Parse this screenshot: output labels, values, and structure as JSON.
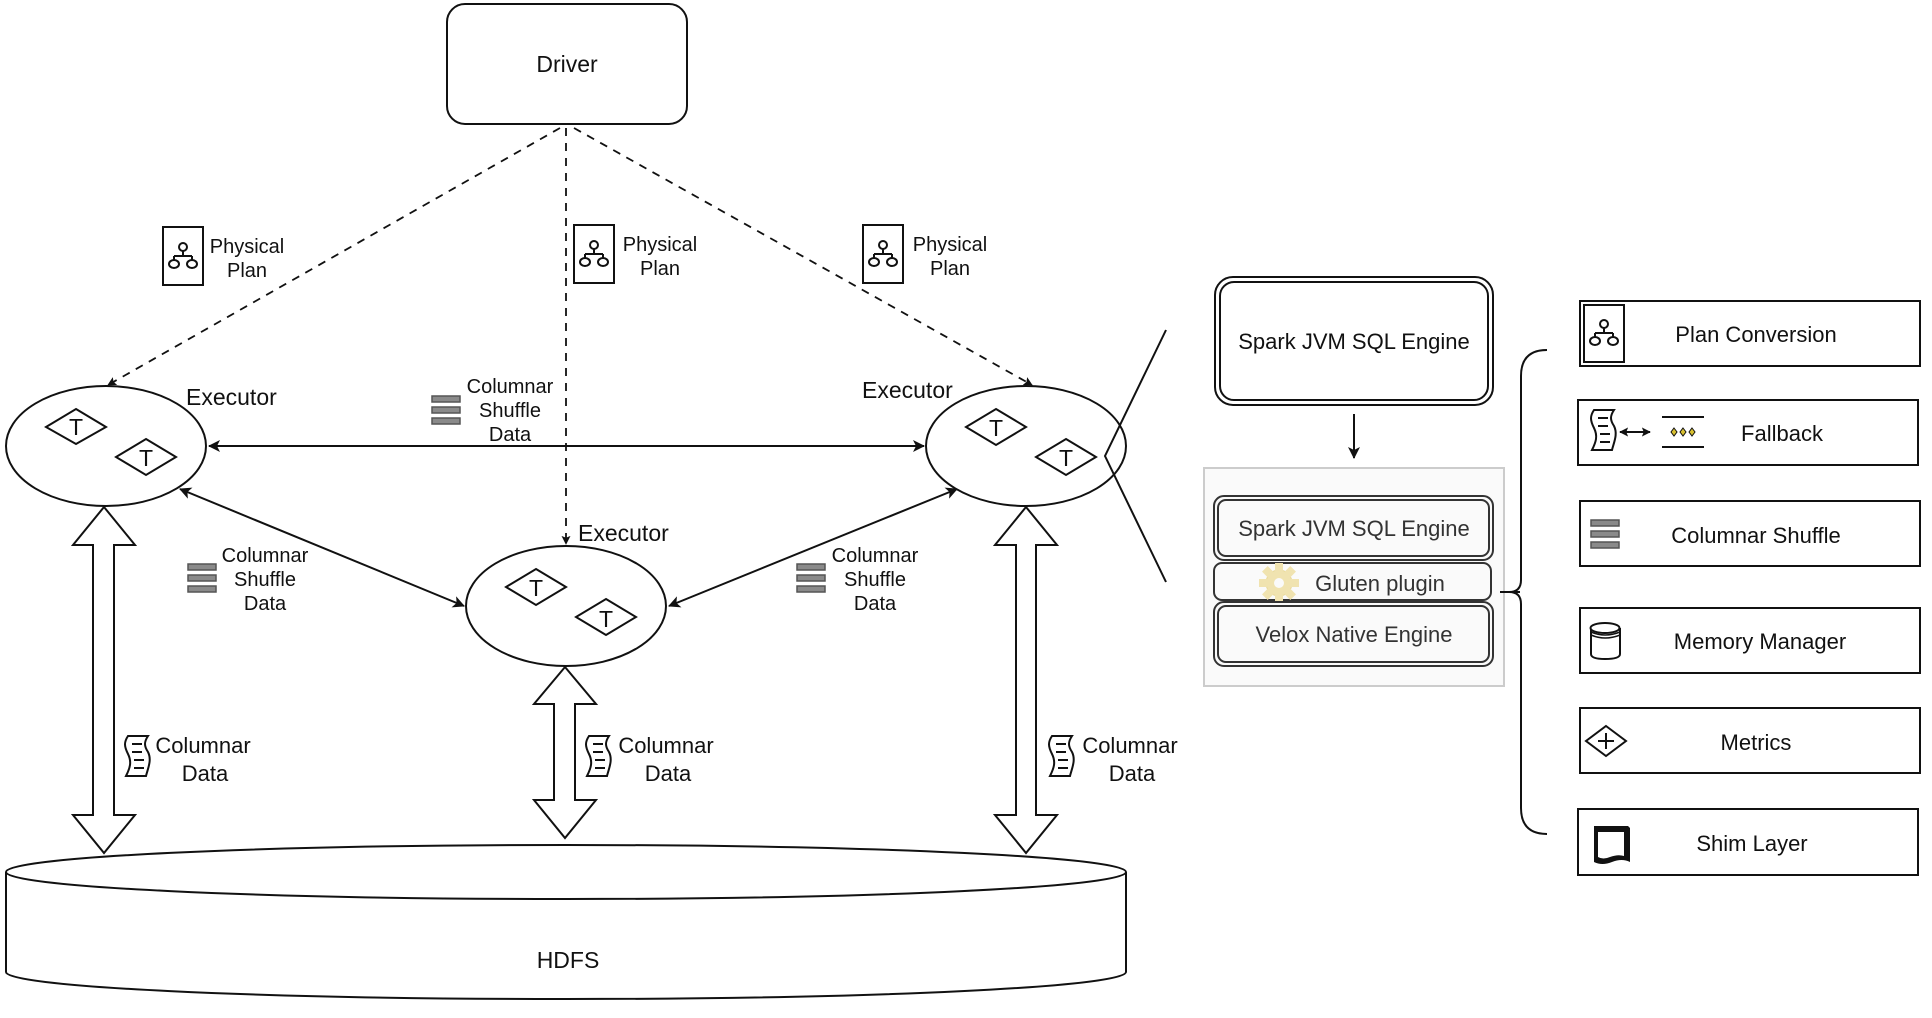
{
  "driver": {
    "label": "Driver"
  },
  "physical_plans": [
    {
      "line1": "Physical",
      "line2": "Plan",
      "icon": "hierarchy-icon"
    },
    {
      "line1": "Physical",
      "line2": "Plan",
      "icon": "hierarchy-icon"
    },
    {
      "line1": "Physical",
      "line2": "Plan",
      "icon": "hierarchy-icon"
    }
  ],
  "executors": [
    {
      "label": "Executor",
      "tasks": [
        "T",
        "T"
      ]
    },
    {
      "label": "Executor",
      "tasks": [
        "T",
        "T"
      ]
    },
    {
      "label": "Executor",
      "tasks": [
        "T",
        "T"
      ]
    }
  ],
  "shuffle_labels": [
    {
      "line1": "Columnar",
      "line2": "Shuffle",
      "line3": "Data",
      "icon": "stacked-bars-icon"
    },
    {
      "line1": "Columnar",
      "line2": "Shuffle",
      "line3": "Data",
      "icon": "stacked-bars-icon"
    },
    {
      "line1": "Columnar",
      "line2": "Shuffle",
      "line3": "Data",
      "icon": "stacked-bars-icon"
    }
  ],
  "data_labels": [
    {
      "line1": "Columnar",
      "line2": "Data",
      "icon": "scroll-icon"
    },
    {
      "line1": "Columnar",
      "line2": "Data",
      "icon": "scroll-icon"
    },
    {
      "line1": "Columnar",
      "line2": "Data",
      "icon": "scroll-icon"
    }
  ],
  "storage": {
    "label": "HDFS"
  },
  "engine_top": {
    "label": "Spark JVM SQL Engine"
  },
  "stack": {
    "layers": [
      {
        "label": "Spark JVM SQL Engine"
      },
      {
        "label": "Gluten plugin",
        "icon": "gear-icon"
      },
      {
        "label": "Velox Native Engine"
      }
    ]
  },
  "components": [
    {
      "label": "Plan Conversion",
      "icon": "hierarchy-icon"
    },
    {
      "label": "Fallback",
      "icon": "scroll-exchange-icon"
    },
    {
      "label": "Columnar Shuffle",
      "icon": "stacked-bars-icon"
    },
    {
      "label": "Memory Manager",
      "icon": "database-icon"
    },
    {
      "label": "Metrics",
      "icon": "diamond-plus-icon"
    },
    {
      "label": "Shim Layer",
      "icon": "document-icon"
    }
  ],
  "colors": {
    "stroke": "#111111",
    "shuffle_bar_fill": "#8a8a8a",
    "shuffle_bar_stroke": "#555555",
    "stack_panel_bg": "#fafafa",
    "stack_panel_border": "#cccccc",
    "gear": "#f0e3b0"
  }
}
